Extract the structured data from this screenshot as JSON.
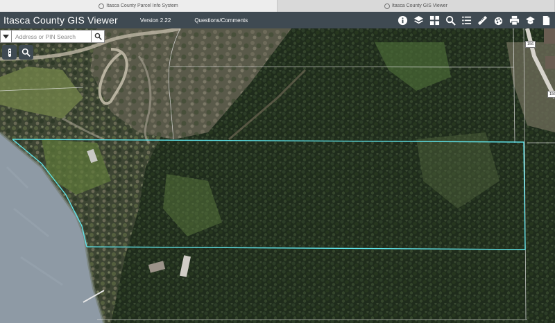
{
  "browser": {
    "tabs": [
      {
        "label": "Itasca County Parcel Info System",
        "active": true
      },
      {
        "label": "Itasca County GIS Viewer",
        "active": false
      }
    ]
  },
  "header": {
    "title": "Itasca County GIS Viewer",
    "version": "Version 2.22",
    "questions_link": "Questions/Comments",
    "tools": [
      "info-icon",
      "layers-icon",
      "basemap-grid-icon",
      "search-icon",
      "legend-list-icon",
      "measure-ruler-icon",
      "draw-icon",
      "print-icon",
      "education-cap-icon",
      "export-icon"
    ]
  },
  "search": {
    "placeholder": "Address or PIN Search",
    "value": ""
  },
  "map": {
    "road_labels": [
      "156",
      "156"
    ],
    "parcel_line_color": "#5fe3ea",
    "plat_line_color": "#dcdcdc"
  }
}
